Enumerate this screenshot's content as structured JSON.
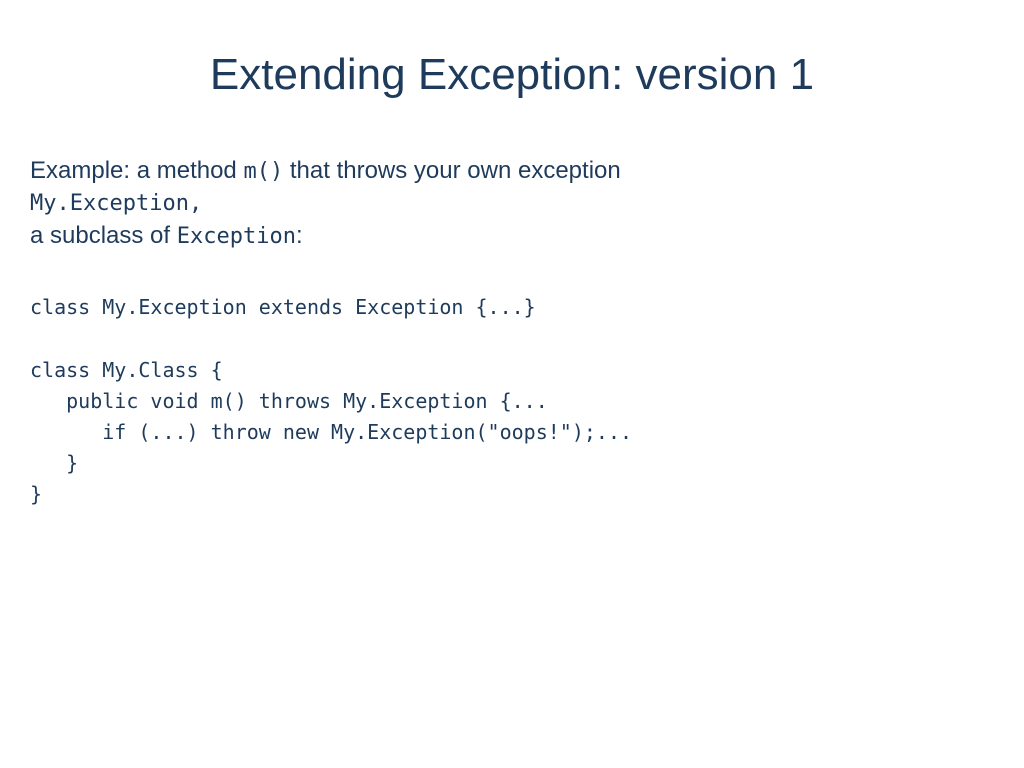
{
  "title": "Extending Exception: version 1",
  "intro": {
    "part1": "Example: a method ",
    "inline1": "m()",
    "part2": " that throws your own exception",
    "line2": "My.Exception,",
    "part3": "a subclass of ",
    "inline2": "Exception",
    "part4": ":"
  },
  "code1": "class My.Exception extends Exception {...}",
  "code2": "class My.Class {\n   public void m() throws My.Exception {...\n      if (...) throw new My.Exception(\"oops!\");...\n   }\n}"
}
